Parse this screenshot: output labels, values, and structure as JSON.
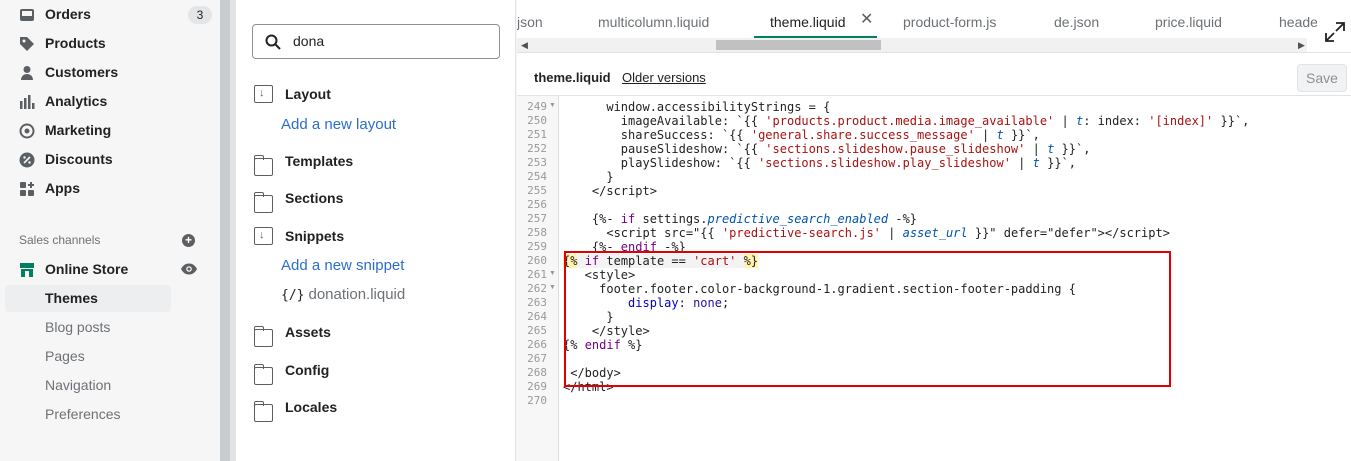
{
  "sidebar": {
    "items": [
      {
        "label": "Orders",
        "badge": "3"
      },
      {
        "label": "Products"
      },
      {
        "label": "Customers"
      },
      {
        "label": "Analytics"
      },
      {
        "label": "Marketing"
      },
      {
        "label": "Discounts"
      },
      {
        "label": "Apps"
      }
    ],
    "sales_channels_label": "Sales channels",
    "online_store_label": "Online Store",
    "sub_items": [
      "Themes",
      "Blog posts",
      "Pages",
      "Navigation",
      "Preferences"
    ]
  },
  "file_tree": {
    "search_value": "dona",
    "folders": [
      "Layout",
      "Templates",
      "Sections",
      "Snippets",
      "Assets",
      "Config",
      "Locales"
    ],
    "add_layout": "Add a new layout",
    "add_snippet": "Add a new snippet",
    "snippet_file": "donation.liquid",
    "snippet_file_icon": "{/}"
  },
  "editor": {
    "tabs": [
      "json",
      "multicolumn.liquid",
      "theme.liquid",
      "product-form.js",
      "de.json",
      "price.liquid",
      "heade"
    ],
    "active_tab": "theme.liquid",
    "file_title": "theme.liquid",
    "older_versions": "Older versions",
    "save_label": "Save",
    "line_numbers": [
      "249",
      "250",
      "251",
      "252",
      "253",
      "254",
      "255",
      "256",
      "257",
      "258",
      "259",
      "260",
      "261",
      "262",
      "263",
      "264",
      "265",
      "266",
      "267",
      "268",
      "269",
      "270"
    ]
  },
  "colors": {
    "accent": "#008060",
    "link": "#2c6ecb",
    "highlight_box": "#e00000"
  }
}
